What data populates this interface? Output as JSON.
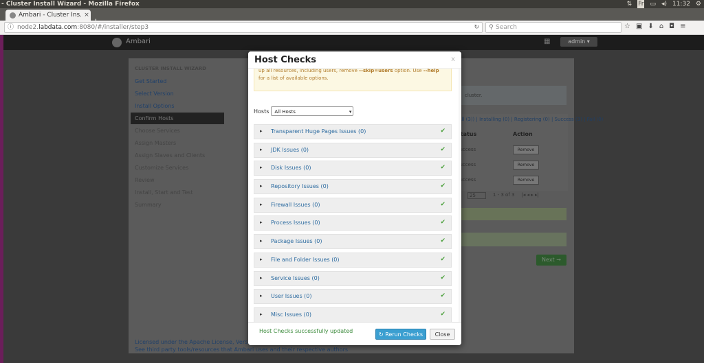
{
  "os": {
    "window_title": "- Cluster Install Wizard - Mozilla Firefox",
    "clock": "11:32",
    "tray_icons": [
      "network-icon",
      "keyboard-layout-icon",
      "battery-icon",
      "volume-icon",
      "settings-icon"
    ],
    "tray_fr": "Fr"
  },
  "browser": {
    "tab_title": "Ambari - Cluster Ins...",
    "tab_close": "×",
    "new_tab": "+",
    "url_host": "node2.",
    "url_domain": "labdata.com",
    "url_path": ":8080/#/installer/step3",
    "search_placeholder": "Search"
  },
  "app": {
    "brand": "Ambari",
    "user_menu": "admin ▾"
  },
  "sidebar": {
    "heading": "CLUSTER INSTALL WIZARD",
    "items": [
      {
        "label": "Get Started"
      },
      {
        "label": "Select Version"
      },
      {
        "label": "Install Options"
      },
      {
        "label": "Confirm Hosts"
      },
      {
        "label": "Choose Services"
      },
      {
        "label": "Assign Masters"
      },
      {
        "label": "Assign Slaves and Clients"
      },
      {
        "label": "Customize Services"
      },
      {
        "label": "Review"
      },
      {
        "label": "Install, Start and Test"
      },
      {
        "label": "Summary"
      }
    ]
  },
  "background": {
    "note": "cluster.",
    "links": "(All (3)) | Installing (0) | Registering (0) | Success (3) | Fail (0)",
    "col_status": "Status",
    "col_action": "Action",
    "rows": [
      {
        "status": "Success",
        "action": "Remove"
      },
      {
        "status": "Success",
        "action": "Remove"
      },
      {
        "status": "Success",
        "action": "Remove"
      }
    ],
    "pager_show": "25",
    "pager_range": "1 - 3 of 3",
    "next": "Next →"
  },
  "footer": {
    "line1": "Licensed under the Apache License, Version 2.0.",
    "line2": "See third party tools/resources that Ambari uses and their respective authors"
  },
  "modal": {
    "title": "Host Checks",
    "close_x": "x",
    "warning_line1": "up all resources, including users, remove ",
    "warning_flag": "--skip=users",
    "warning_line1b": " option. Use ",
    "warning_help": "--help",
    "warning_line2": "for a list of available options.",
    "hosts_label": "Hosts",
    "hosts_value": "All Hosts",
    "checks": [
      {
        "label": "Transparent Huge Pages Issues (0)"
      },
      {
        "label": "JDK Issues (0)"
      },
      {
        "label": "Disk Issues (0)"
      },
      {
        "label": "Repository Issues (0)"
      },
      {
        "label": "Firewall Issues (0)"
      },
      {
        "label": "Process Issues (0)"
      },
      {
        "label": "Package Issues (0)"
      },
      {
        "label": "File and Folder Issues (0)"
      },
      {
        "label": "Service Issues (0)"
      },
      {
        "label": "User Issues (0)"
      },
      {
        "label": "Misc Issues (0)"
      }
    ],
    "status_message": "Host Checks successfully updated",
    "rerun_label": "Rerun Checks",
    "close_label": "Close"
  }
}
